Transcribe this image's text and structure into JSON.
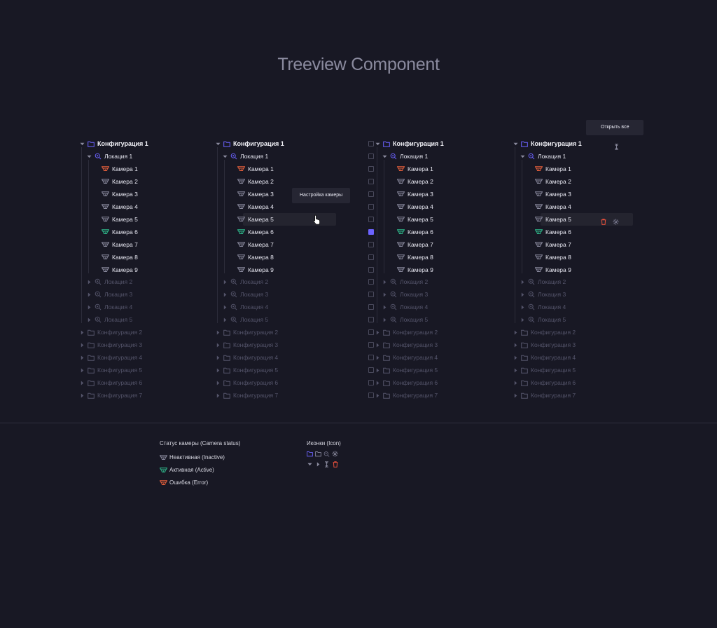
{
  "page_title": "Treeview Component",
  "configs": [
    "Конфигурация 1",
    "Конфигурация 2",
    "Конфигурация 3",
    "Конфигурация 4",
    "Конфигурация 5",
    "Конфигурация 6",
    "Конфигурация 7"
  ],
  "locations": [
    "Локация 1",
    "Локация 2",
    "Локация 3",
    "Локация 4",
    "Локация 5"
  ],
  "cameras": [
    {
      "label": "Камера 1",
      "status": "error"
    },
    {
      "label": "Камера 2",
      "status": "inactive"
    },
    {
      "label": "Камера 3",
      "status": "inactive"
    },
    {
      "label": "Камера 4",
      "status": "inactive"
    },
    {
      "label": "Камера 5",
      "status": "inactive"
    },
    {
      "label": "Камера 6",
      "status": "active"
    },
    {
      "label": "Камера 7",
      "status": "inactive"
    },
    {
      "label": "Камера 8",
      "status": "inactive"
    },
    {
      "label": "Камера 9",
      "status": "inactive"
    }
  ],
  "variants": [
    {
      "checkbox": false,
      "hover_camera": null,
      "tooltip": null,
      "actions": false
    },
    {
      "checkbox": false,
      "hover_camera": 4,
      "tooltip": "Настройка камеры",
      "actions": false
    },
    {
      "checkbox": true,
      "checked_camera": 5,
      "hover_camera": null,
      "tooltip": null,
      "actions": false
    },
    {
      "checkbox": false,
      "hover_camera": 4,
      "tooltip": "Открыть все",
      "actions": true
    }
  ],
  "legend": {
    "status_title": "Статус камеры (Camera status)",
    "statuses": [
      {
        "label": "Неактивная (Inactive)",
        "status": "inactive"
      },
      {
        "label": "Активная (Active)",
        "status": "active"
      },
      {
        "label": "Ошибка (Error)",
        "status": "error"
      }
    ],
    "icons_title": "Иконки (Icon)"
  },
  "colors": {
    "background": "#181824",
    "accent": "#6c63ff",
    "active": "#2fbf8f",
    "error": "#e8603c",
    "inactive": "#8a8a9e",
    "dim": "#54546a",
    "delete": "#e8503c"
  },
  "icons": {
    "folder": "folder-icon",
    "location": "location-icon",
    "camera": "camera-icon",
    "caret_down": "caret-down-icon",
    "caret_right": "caret-right-icon",
    "gear": "gear-icon",
    "trash": "trash-icon",
    "expand": "expand-all-icon"
  }
}
